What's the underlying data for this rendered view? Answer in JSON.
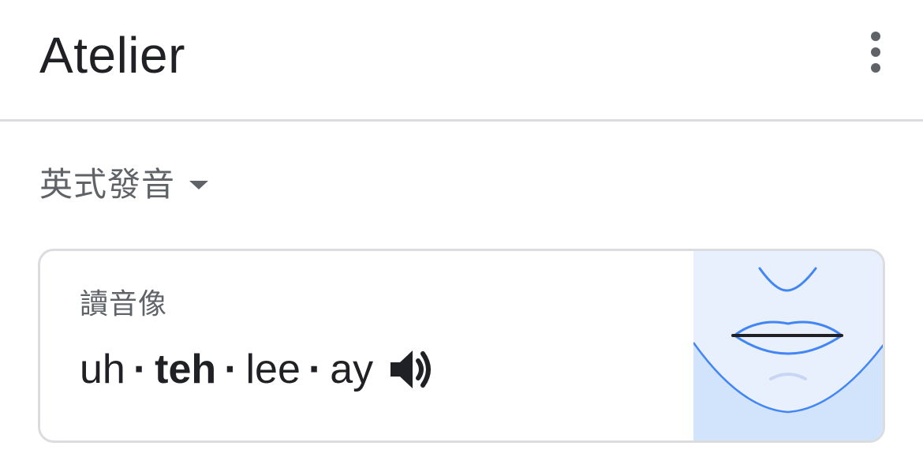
{
  "header": {
    "title": "Atelier",
    "more_icon": "more-vert-icon"
  },
  "dialect": {
    "label": "英式發音",
    "dropdown_icon": "arrow-drop-down-icon"
  },
  "pronunciation": {
    "sounds_like_label": "讀音像",
    "syllables": [
      "uh",
      "teh",
      "lee",
      "ay"
    ],
    "stressed_syllable": "teh",
    "separator": "·",
    "speaker_icon": "volume-up-icon",
    "illustration": "mouth-diagram"
  },
  "colors": {
    "accent_blue": "#4285f4",
    "illustration_bg": "#e8f0fe",
    "illustration_chin": "#d2e3fc",
    "text_primary": "#202124",
    "text_secondary": "#5f6368",
    "divider": "#dadce0"
  }
}
